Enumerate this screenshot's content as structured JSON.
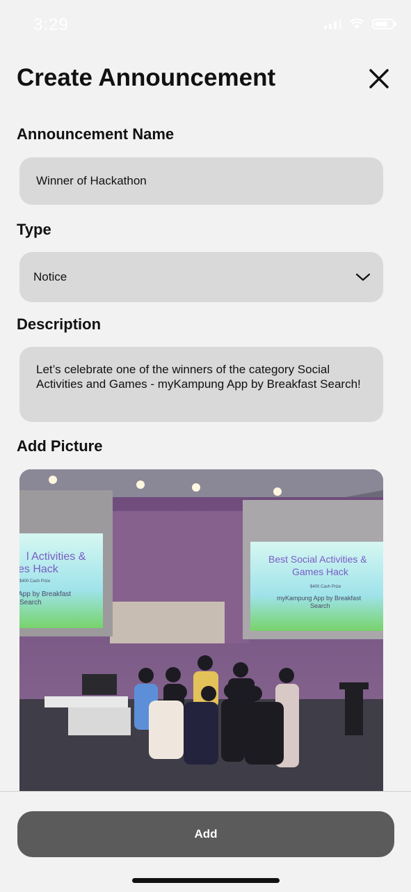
{
  "status": {
    "time": "3:29"
  },
  "header": {
    "title": "Create Announcement",
    "close_icon": "close-icon"
  },
  "form": {
    "name_label": "Announcement Name",
    "name_value": "Winner of Hackathon",
    "type_label": "Type",
    "type_value": "Notice",
    "description_label": "Description",
    "description_value": "Let’s celebrate one of the winners of the category Social Activities and Games - myKampung App by Breakfast Search!",
    "picture_label": "Add Picture"
  },
  "photo": {
    "left_screen_lines": [
      "l Activities &",
      "es Hack"
    ],
    "left_screen_small": "$400 Cash Prize",
    "left_screen_sub": [
      "App by Breakfast",
      "Search"
    ],
    "right_screen_lines": [
      "Best Social Activities &",
      "Games Hack"
    ],
    "right_screen_small": "$400 Cash Prize",
    "right_screen_sub": [
      "myKampung App by Breakfast",
      "Search"
    ]
  },
  "footer": {
    "add_label": "Add"
  }
}
